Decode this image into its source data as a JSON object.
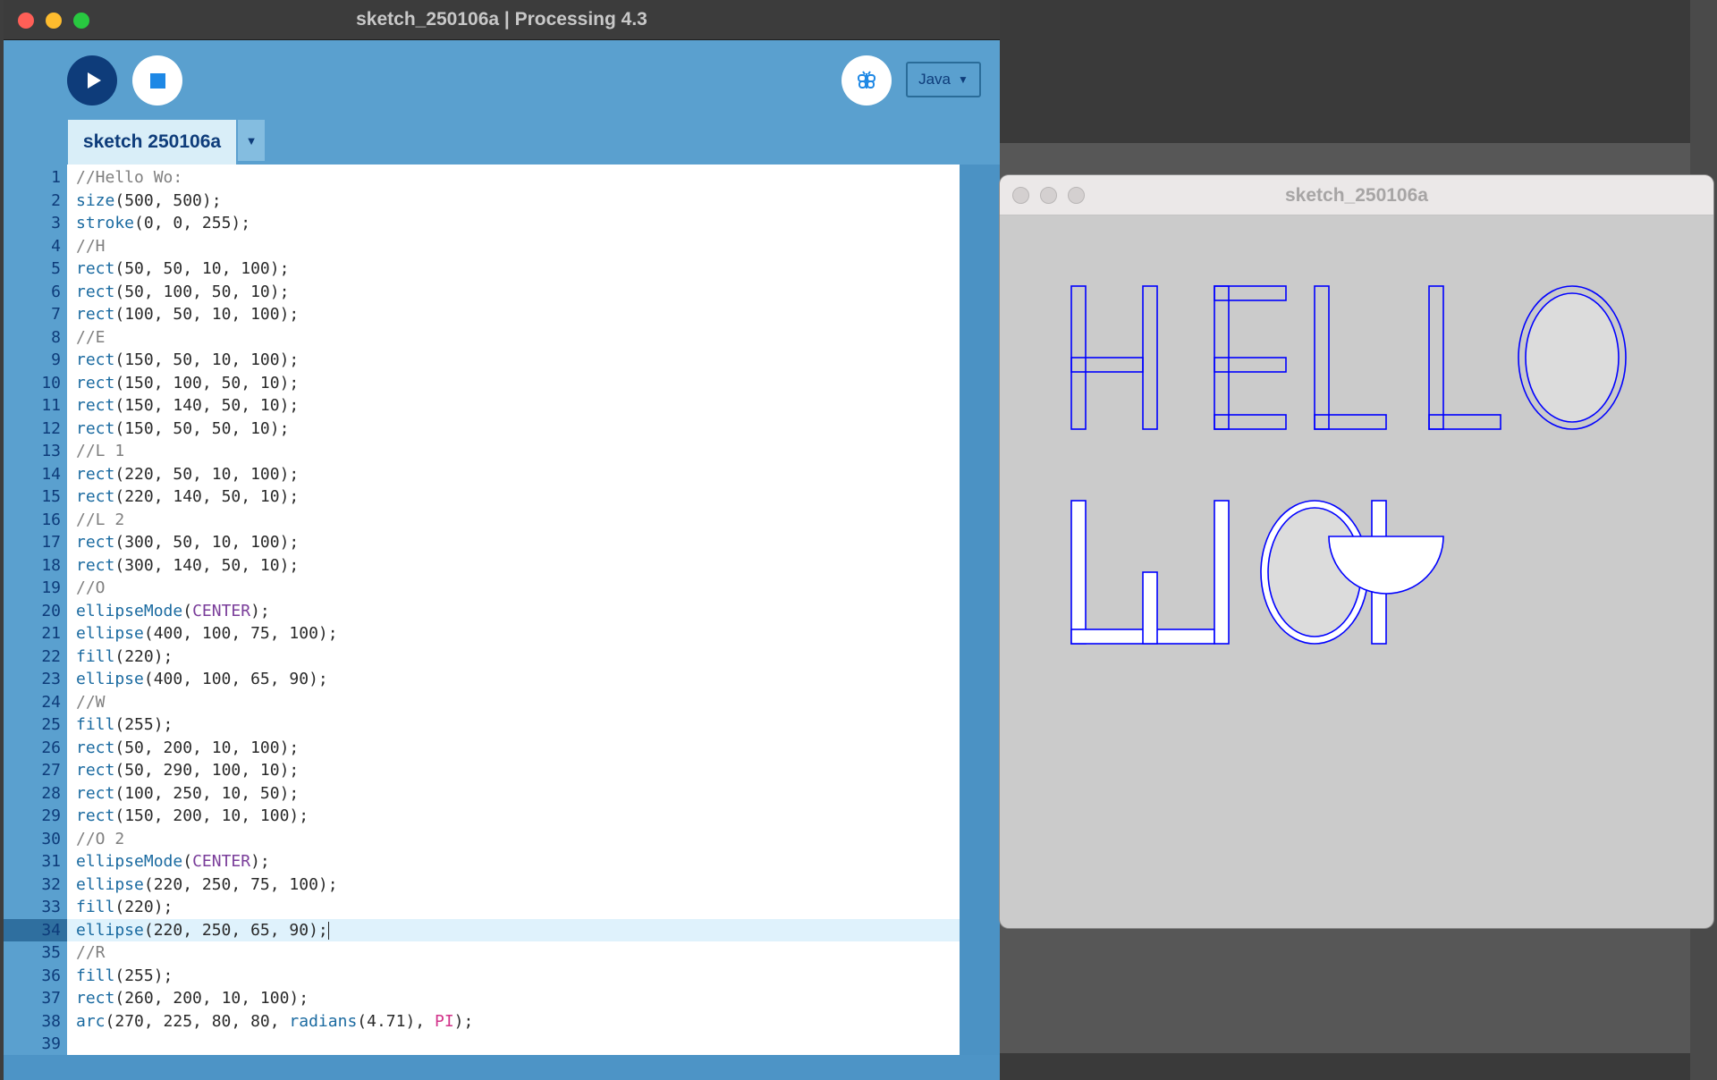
{
  "ide": {
    "window_title": "sketch_250106a | Processing 4.3",
    "mode_label": "Java",
    "tab_label": "sketch 250106a",
    "current_line": 34
  },
  "code_lines": [
    [
      [
        "c-com",
        "//Hello Wo:"
      ]
    ],
    [
      [
        "c-fn",
        "size"
      ],
      [
        "",
        "(500, 500);"
      ]
    ],
    [
      [
        "c-fn",
        "stroke"
      ],
      [
        "",
        "(0, 0, 255);"
      ]
    ],
    [
      [
        "c-com",
        "//H"
      ]
    ],
    [
      [
        "c-fn",
        "rect"
      ],
      [
        "",
        "(50, 50, 10, 100);"
      ]
    ],
    [
      [
        "c-fn",
        "rect"
      ],
      [
        "",
        "(50, 100, 50, 10);"
      ]
    ],
    [
      [
        "c-fn",
        "rect"
      ],
      [
        "",
        "(100, 50, 10, 100);"
      ]
    ],
    [
      [
        "c-com",
        "//E"
      ]
    ],
    [
      [
        "c-fn",
        "rect"
      ],
      [
        "",
        "(150, 50, 10, 100);"
      ]
    ],
    [
      [
        "c-fn",
        "rect"
      ],
      [
        "",
        "(150, 100, 50, 10);"
      ]
    ],
    [
      [
        "c-fn",
        "rect"
      ],
      [
        "",
        "(150, 140, 50, 10);"
      ]
    ],
    [
      [
        "c-fn",
        "rect"
      ],
      [
        "",
        "(150, 50, 50, 10);"
      ]
    ],
    [
      [
        "c-com",
        "//L 1"
      ]
    ],
    [
      [
        "c-fn",
        "rect"
      ],
      [
        "",
        "(220, 50, 10, 100);"
      ]
    ],
    [
      [
        "c-fn",
        "rect"
      ],
      [
        "",
        "(220, 140, 50, 10);"
      ]
    ],
    [
      [
        "c-com",
        "//L 2"
      ]
    ],
    [
      [
        "c-fn",
        "rect"
      ],
      [
        "",
        "(300, 50, 10, 100);"
      ]
    ],
    [
      [
        "c-fn",
        "rect"
      ],
      [
        "",
        "(300, 140, 50, 10);"
      ]
    ],
    [
      [
        "c-com",
        "//O"
      ]
    ],
    [
      [
        "c-fn",
        "ellipseMode"
      ],
      [
        "",
        "("
      ],
      [
        "c-const",
        "CENTER"
      ],
      [
        "",
        ");"
      ]
    ],
    [
      [
        "c-fn",
        "ellipse"
      ],
      [
        "",
        "(400, 100, 75, 100);"
      ]
    ],
    [
      [
        "c-fn",
        "fill"
      ],
      [
        "",
        "(220);"
      ]
    ],
    [
      [
        "c-fn",
        "ellipse"
      ],
      [
        "",
        "(400, 100, 65, 90);"
      ]
    ],
    [
      [
        "c-com",
        "//W"
      ]
    ],
    [
      [
        "c-fn",
        "fill"
      ],
      [
        "",
        "(255);"
      ]
    ],
    [
      [
        "c-fn",
        "rect"
      ],
      [
        "",
        "(50, 200, 10, 100);"
      ]
    ],
    [
      [
        "c-fn",
        "rect"
      ],
      [
        "",
        "(50, 290, 100, 10);"
      ]
    ],
    [
      [
        "c-fn",
        "rect"
      ],
      [
        "",
        "(100, 250, 10, 50);"
      ]
    ],
    [
      [
        "c-fn",
        "rect"
      ],
      [
        "",
        "(150, 200, 10, 100);"
      ]
    ],
    [
      [
        "c-com",
        "//O 2"
      ]
    ],
    [
      [
        "c-fn",
        "ellipseMode"
      ],
      [
        "",
        "("
      ],
      [
        "c-const",
        "CENTER"
      ],
      [
        "",
        ");"
      ]
    ],
    [
      [
        "c-fn",
        "ellipse"
      ],
      [
        "",
        "(220, 250, 75, 100);"
      ]
    ],
    [
      [
        "c-fn",
        "fill"
      ],
      [
        "",
        "(220);"
      ]
    ],
    [
      [
        "c-fn",
        "ellipse"
      ],
      [
        "",
        "(220, 250, 65, 90);"
      ]
    ],
    [
      [
        "c-com",
        "//R"
      ]
    ],
    [
      [
        "c-fn",
        "fill"
      ],
      [
        "",
        "(255);"
      ]
    ],
    [
      [
        "c-fn",
        "rect"
      ],
      [
        "",
        "(260, 200, 10, 100);"
      ]
    ],
    [
      [
        "c-fn",
        "arc"
      ],
      [
        "",
        "(270, 225, 80, 80, "
      ],
      [
        "c-fn",
        "radians"
      ],
      [
        "",
        "(4.71), "
      ],
      [
        "c-pi",
        "PI"
      ],
      [
        "",
        ");"
      ]
    ],
    []
  ],
  "sketch": {
    "window_title": "sketch_250106a",
    "stroke_color": "#0000ff",
    "background_color": "#cbcbcb"
  },
  "colors": {
    "ide_accent": "#5aa0cf",
    "run_button": "#0e3c7a",
    "stop_icon": "#1e88e5"
  }
}
